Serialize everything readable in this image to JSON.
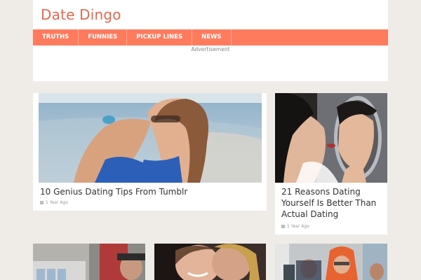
{
  "site": {
    "title": "Date Dingo"
  },
  "nav": {
    "items": [
      {
        "label": "TRUTHS"
      },
      {
        "label": "FUNNIES"
      },
      {
        "label": "PICKUP LINES"
      },
      {
        "label": "NEWS"
      }
    ]
  },
  "ad": {
    "label": "Advertisement"
  },
  "colors": {
    "accent": "#ff7b5e",
    "title": "#e4684f",
    "background": "#efece8"
  },
  "cards": [
    {
      "title": "10 Genius Dating Tips From Tumblr",
      "meta": "1 Year Ago",
      "calendar_icon": "calendar-icon"
    },
    {
      "title": "21 Reasons Dating Yourself Is Better Than Actual Dating",
      "meta": "1 Year Ago",
      "calendar_icon": "calendar-icon"
    }
  ]
}
